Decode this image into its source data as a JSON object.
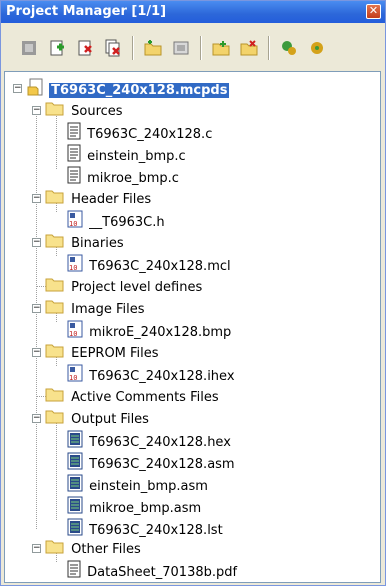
{
  "window": {
    "title": "Project Manager [1/1]"
  },
  "toolbar": {
    "buttons": [
      "open-project-icon",
      "add-file-icon",
      "remove-file-icon",
      "remove-all-icon",
      "new-folder-icon",
      "folder-icon",
      "add-folder-icon",
      "delete-folder-icon",
      "build-icon",
      "options-icon"
    ]
  },
  "tree": {
    "root": "T6963C_240x128.mcpds",
    "sources": {
      "label": "Sources",
      "items": [
        "T6963C_240x128.c",
        "einstein_bmp.c",
        "mikroe_bmp.c"
      ]
    },
    "headers": {
      "label": "Header Files",
      "items": [
        "__T6963C.h"
      ]
    },
    "binaries": {
      "label": "Binaries",
      "items": [
        "T6963C_240x128.mcl"
      ]
    },
    "defines": {
      "label": "Project level defines"
    },
    "images": {
      "label": "Image Files",
      "items": [
        "mikroE_240x128.bmp"
      ]
    },
    "eeprom": {
      "label": "EEPROM Files",
      "items": [
        "T6963C_240x128.ihex"
      ]
    },
    "comments": {
      "label": "Active Comments Files"
    },
    "output": {
      "label": "Output Files",
      "items": [
        "T6963C_240x128.hex",
        "T6963C_240x128.asm",
        "einstein_bmp.asm",
        "mikroe_bmp.asm",
        "T6963C_240x128.lst"
      ]
    },
    "other": {
      "label": "Other Files",
      "items": [
        "DataSheet_70138b.pdf"
      ]
    }
  }
}
